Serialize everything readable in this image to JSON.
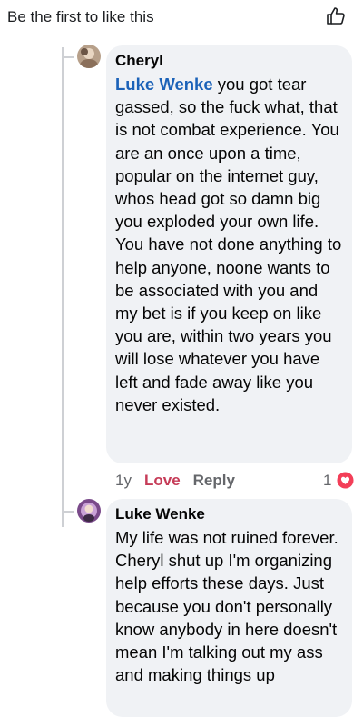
{
  "header": {
    "text": "Be the first to like this",
    "like_icon": "thumbs-up-outline-icon"
  },
  "comments": [
    {
      "author": "Cheryl",
      "mention": "Luke Wenke",
      "text": " you got tear gassed, so the fuck what, that is not combat experience. You are an once upon a time, popular on the internet guy, whos head got so damn big you exploded your own life. You have not done anything to help anyone, noone wants to be associated with you and my bet is if you keep on like you are,  within two years you will lose whatever you have left and fade away like you never existed.",
      "time": "1y",
      "reaction_label": "Love",
      "reply_label": "Reply",
      "reaction_count": "1",
      "reaction_icon": "love-reaction-icon"
    },
    {
      "author": "Luke Wenke",
      "text": "My life was not ruined forever.  Cheryl shut up I'm organizing help efforts these days.  Just because you don't personally know anybody in here doesn't mean I'm talking out my ass and making things up"
    }
  ],
  "colors": {
    "bubble": "#f0f2f5",
    "mention": "#1b62b8",
    "love": "#c63c58",
    "meta": "#65676b"
  }
}
